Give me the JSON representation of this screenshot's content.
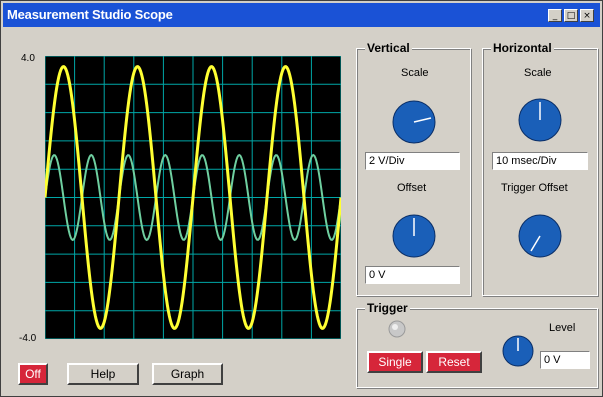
{
  "window": {
    "title": "Measurement Studio Scope",
    "controls": [
      "_",
      "□",
      "×"
    ]
  },
  "graph": {
    "y_max_label": "4.0",
    "y_min_label": "-4.0",
    "grid_divisions": {
      "x": 10,
      "y": 10
    },
    "colors": {
      "background": "#000000",
      "grid": "#00a7a7",
      "trace1": "#ffff33",
      "trace2": "#6fcfa0"
    },
    "traces": [
      {
        "color": "#ffff33",
        "amplitude": 3.7,
        "cycles": 4
      },
      {
        "color": "#6fcfa0",
        "amplitude": 1.2,
        "cycles": 8
      }
    ]
  },
  "bottom_buttons": {
    "off": "Off",
    "help": "Help",
    "graph": "Graph"
  },
  "vertical": {
    "title": "Vertical",
    "scale_label": "Scale",
    "scale_value": "2 V/Div",
    "offset_label": "Offset",
    "offset_value": "0 V"
  },
  "horizontal": {
    "title": "Horizontal",
    "scale_label": "Scale",
    "scale_value": "10 msec/Div",
    "trigger_offset_label": "Trigger Offset"
  },
  "trigger": {
    "title": "Trigger",
    "single": "Single",
    "reset": "Reset",
    "level_label": "Level",
    "level_value": "0 V"
  },
  "accent_colors": {
    "title_bar": "#1a52d6",
    "knob": "#1a5fb8",
    "red_button": "#d6263a"
  }
}
